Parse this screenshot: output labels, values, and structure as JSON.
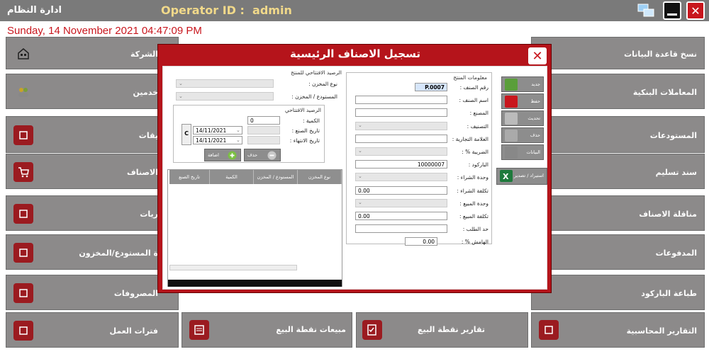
{
  "window": {
    "app_title": "ادارة النظام",
    "operator_label": "Operator ID :",
    "operator_value": "admin",
    "close_glyph": "✕",
    "datetime": "Sunday, 14 November 2021 04:47:09 PM"
  },
  "tiles": {
    "col4": [
      {
        "label": "نسخ قاعدة البيانات",
        "icon": "database-copy-icon"
      },
      {
        "label": "المعاملات البنكية",
        "icon": "bank-transactions-icon"
      },
      {
        "label": "المستودعات",
        "icon": "warehouse-icon"
      },
      {
        "label": "سند تسليم",
        "icon": "delivery-receipt-icon"
      },
      {
        "label": "مناقلة الاصناف",
        "icon": "item-transfer-icon"
      },
      {
        "label": "المدفوعات",
        "icon": "payments-icon"
      },
      {
        "label": "طباعة الباركود",
        "icon": "barcode-print-icon"
      },
      {
        "label": "التقارير المحاسبية",
        "icon": "accounting-reports-icon"
      }
    ],
    "col1": [
      {
        "label": "الشركة",
        "icon": "building-icon"
      },
      {
        "label": "خدمين",
        "icon": "users-icon"
      },
      {
        "label": "يقات",
        "icon": "network-icon"
      },
      {
        "label": "الاصناف",
        "icon": "cart-icon"
      },
      {
        "label": "ريات",
        "icon": "bag-icon"
      },
      {
        "label": "ة المستودع/المخزون",
        "icon": "tag-icon"
      },
      {
        "label": "المصروفات",
        "icon": "expenses-icon"
      },
      {
        "label": "فترات العمل",
        "icon": "work-periods-icon"
      }
    ],
    "bottom_mid": [
      {
        "label": "مبيعات نقطة البيع",
        "icon": "pos-sales-icon"
      },
      {
        "label": "تقارير نقطة البيع",
        "icon": "pos-reports-icon"
      }
    ]
  },
  "modal": {
    "title": "تسجيل الاصناف الرئيسية",
    "close_glyph": "✕",
    "product_info": {
      "section_title": "معلومات المنتج",
      "fields": [
        {
          "label": "رقم الصنف :",
          "value": "P.0007"
        },
        {
          "label": "اسم الصنف :",
          "value": ""
        },
        {
          "label": "المصنع :",
          "value": ""
        },
        {
          "label": "التصنيف :",
          "value": ""
        },
        {
          "label": "العلامة التجارية :",
          "value": ""
        },
        {
          "label": "الضريبة % :",
          "value": ""
        },
        {
          "label": "الباركود :",
          "value": "10000007"
        },
        {
          "label": "وحدة الشراء :",
          "value": ""
        },
        {
          "label": "تكلفة الشراء :",
          "value": "0.00"
        },
        {
          "label": "وحدة المبيع :",
          "value": ""
        },
        {
          "label": "تكلفة المبيع :",
          "value": "0.00"
        },
        {
          "label": "حد الطلب :",
          "value": ""
        },
        {
          "label": "الهامش % :",
          "value": "0.00"
        }
      ]
    },
    "actions": [
      {
        "label": "جديد",
        "icon": "new-document-icon"
      },
      {
        "label": "حفظ",
        "icon": "save-icon"
      },
      {
        "label": "تحديث",
        "icon": "refresh-icon"
      },
      {
        "label": "حذف",
        "icon": "delete-icon"
      },
      {
        "label": "البيانات",
        "icon": "database-icon"
      }
    ],
    "excel_button": {
      "label": "استيراد / تصدير",
      "icon": "excel-icon"
    },
    "opening_balance": {
      "section_title": "الرصيد الافتتاحي للمنتج",
      "store_type_label": "نوع المخزن :",
      "warehouse_label": "المستودع / المخزن :",
      "sub_title": "الرصيد الافتتاحي",
      "qty_label": "الكمية :",
      "qty_value": "0",
      "mfg_label": "تاريخ الصنع :",
      "mfg_value": "14/11/2021",
      "exp_label": "تاريخ الانتهاء :",
      "exp_value": "14/11/2021",
      "c_button": "C",
      "delete_label": "حذف",
      "add_label": "اضافة"
    },
    "grid": {
      "columns": [
        "نوع المخزن",
        "المستودع / المخزن",
        "الكمية",
        "تاريخ الصنع"
      ]
    }
  },
  "colors": {
    "accent_red": "#c8161d",
    "tile_gray": "#8c8a8a",
    "operator_gold": "#f1d98a"
  }
}
